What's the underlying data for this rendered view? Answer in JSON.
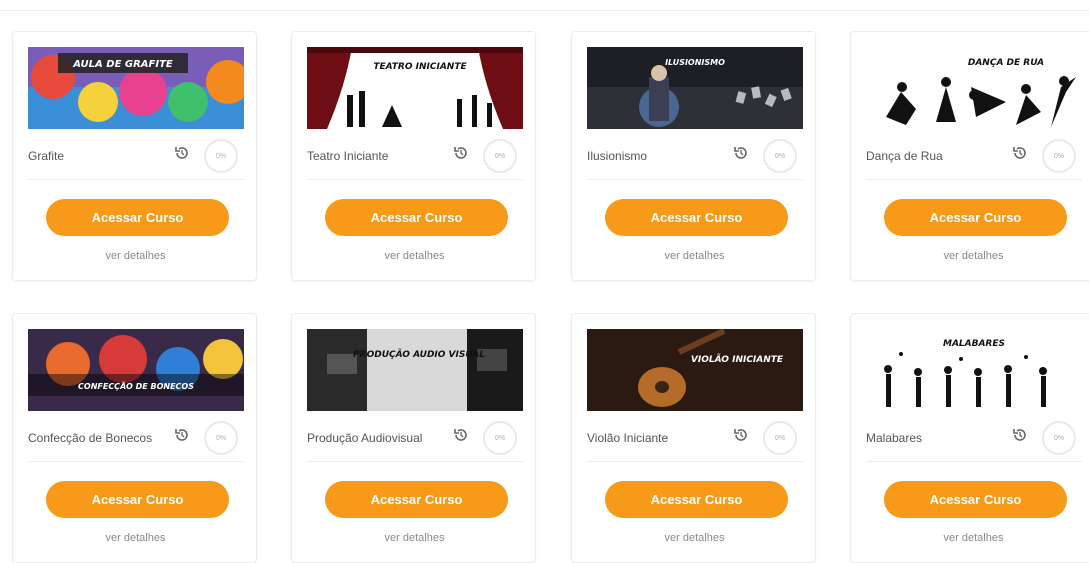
{
  "courses": [
    {
      "title": "Grafite",
      "banner_text": "AULA DE GRAFITE",
      "progress": "0%",
      "button": "Acessar Curso",
      "details": "ver detalhes"
    },
    {
      "title": "Teatro Iniciante",
      "banner_text": "TEATRO INICIANTE",
      "progress": "0%",
      "button": "Acessar Curso",
      "details": "ver detalhes"
    },
    {
      "title": "Ilusionismo",
      "banner_text": "ILUSIONISMO",
      "progress": "0%",
      "button": "Acessar Curso",
      "details": "ver detalhes"
    },
    {
      "title": "Dança de Rua",
      "banner_text": "DANÇA DE RUA",
      "progress": "0%",
      "button": "Acessar Curso",
      "details": "ver detalhes"
    },
    {
      "title": "Confecção de Bonecos",
      "banner_text": "CONFECÇÃO DE BONECOS",
      "progress": "0%",
      "button": "Acessar Curso",
      "details": "ver detalhes"
    },
    {
      "title": "Produção Audiovisual",
      "banner_text": "PRODUÇÃO AUDIO VISUAL",
      "progress": "0%",
      "button": "Acessar Curso",
      "details": "ver detalhes"
    },
    {
      "title": "Violão Iniciante",
      "banner_text": "VIOLÃO INICIANTE",
      "progress": "0%",
      "button": "Acessar Curso",
      "details": "ver detalhes"
    },
    {
      "title": "Malabares",
      "banner_text": "MALABARES",
      "progress": "0%",
      "button": "Acessar Curso",
      "details": "ver detalhes"
    }
  ],
  "colors": {
    "accent": "#f79a1a",
    "border": "#ececec",
    "text": "#555555"
  }
}
